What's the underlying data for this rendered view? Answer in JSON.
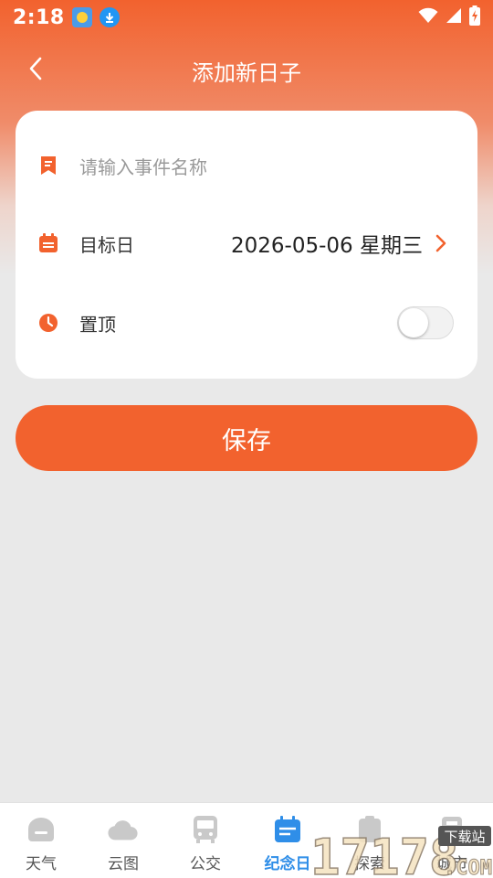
{
  "status_bar": {
    "time": "2:18",
    "icons": [
      "weather-app-icon",
      "download-icon",
      "wifi-icon",
      "signal-icon",
      "battery-charging-icon"
    ]
  },
  "header": {
    "title": "添加新日子",
    "back_icon": "chevron-left-icon"
  },
  "form": {
    "event_name": {
      "icon": "bookmark-icon",
      "value": "",
      "placeholder": "请输入事件名称"
    },
    "target_date": {
      "icon": "calendar-icon",
      "label": "目标日",
      "value": "2026-05-06 星期三",
      "chevron_icon": "chevron-right-icon"
    },
    "pin_top": {
      "icon": "clock-icon",
      "label": "置顶",
      "enabled": false
    }
  },
  "save_button": {
    "label": "保存"
  },
  "bottom_nav": {
    "items": [
      {
        "label": "天气",
        "icon": "weather-home-icon",
        "active": false
      },
      {
        "label": "云图",
        "icon": "cloud-icon",
        "active": false
      },
      {
        "label": "公交",
        "icon": "bus-icon",
        "active": false
      },
      {
        "label": "纪念日",
        "icon": "calendar-nav-icon",
        "active": true
      },
      {
        "label": "探索",
        "icon": "explore-icon",
        "active": false
      },
      {
        "label": "城市",
        "icon": "city-icon",
        "active": false
      }
    ]
  },
  "watermark": {
    "text": "17178.COM",
    "badge": "下载站"
  },
  "colors": {
    "accent": "#f2622e",
    "nav_active": "#2f8ee8",
    "background": "#e9e9e9"
  }
}
